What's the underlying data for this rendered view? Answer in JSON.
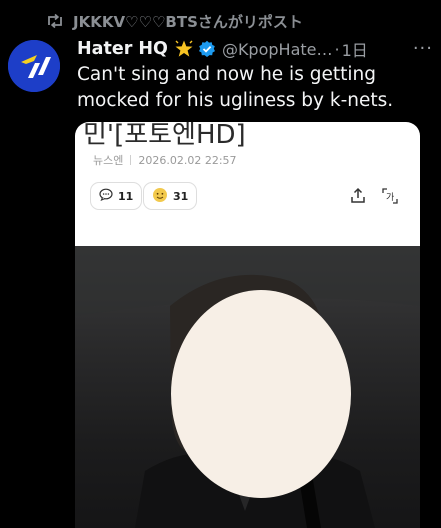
{
  "repost": {
    "icon": "repost-icon",
    "text": "JKKKV♡♡♡BTSさんがリポスト"
  },
  "post": {
    "avatar_icon": "hater-hq-logo",
    "display_name": "Hater HQ",
    "badge_icons": [
      "star-emoji-icon",
      "verified-badge-icon"
    ],
    "handle": "@KpopHate…",
    "separator": "·",
    "time": "1日",
    "more": "···",
    "text": "Can't sing and now he is getting mocked for his ugliness by k-nets."
  },
  "card": {
    "title": "민'[포토엔HD]",
    "source": "뉴스엔",
    "date": "2026.02.02 22:57",
    "comments_count": "11",
    "reactions_count": "31",
    "icons": [
      "comment-icon",
      "reaction-emoji-icon",
      "share-icon",
      "font-size-icon"
    ]
  },
  "colors": {
    "background": "#000000",
    "text": "#e7e9ea",
    "muted": "#8b8f94",
    "verified": "#1d9bf0",
    "avatar": "#1d3ec8",
    "logo_accent": "#f5d020"
  }
}
